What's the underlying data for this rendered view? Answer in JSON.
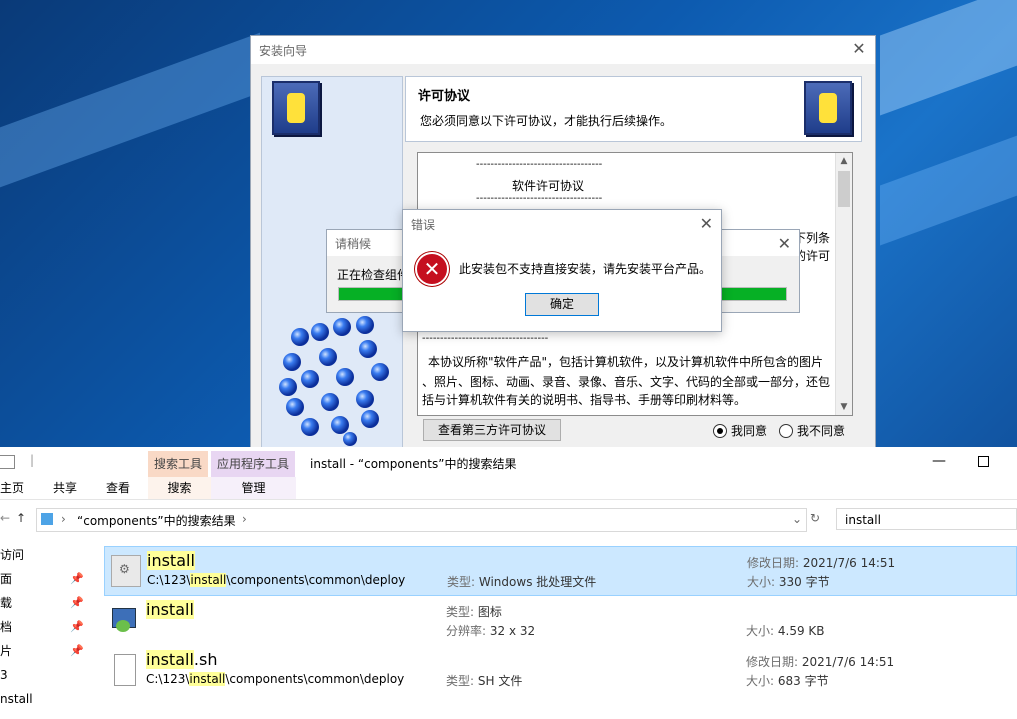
{
  "wizard": {
    "title": "安装向导",
    "header_title": "许可协议",
    "header_sub": "您必须同意以下许可协议，才能执行后续操作。",
    "license_lines": [
      "-----------------------------------",
      "软件许可协议",
      "-----------------------------------",
      "下列条",
      "的许可",
      "-----------------------------------",
      "本协议所称\"软件产品\"，包括计算机软件，以及计算机软件中所包含的图片",
      "、照片、图标、动画、录音、录像、音乐、文字、代码的全部或一部分，还包",
      "括与计算机软件有关的说明书、指导书、手册等印刷材料等。"
    ],
    "third_party_button": "查看第三方许可协议",
    "agree_label": "我同意",
    "disagree_label": "我不同意"
  },
  "wait_dialog": {
    "title": "请稍候",
    "text": "正在检查组件",
    "progress": 1.0
  },
  "error_dialog": {
    "title": "错误",
    "message": "此安装包不支持直接安装，请先安装平台产品。",
    "ok_button": "确定"
  },
  "explorer": {
    "context_tab_search": "搜索工具",
    "context_tab_app": "应用程序工具",
    "window_title": "install - “components”中的搜索结果",
    "ribbon_tabs": [
      "主页",
      "共享",
      "查看",
      "搜索",
      "管理"
    ],
    "address": "“components”中的搜索结果",
    "search_value": "install",
    "nav_items": [
      "访问",
      "面",
      "载",
      "档",
      "片",
      "3",
      "nstall"
    ],
    "results": [
      {
        "name_hl": "install",
        "name_rest": "",
        "path_pre": "C:\\123\\",
        "path_hl": "install",
        "path_post": "\\components\\common\\deploy",
        "type_key": "类型:",
        "type_val": "Windows 批处理文件",
        "date_key": "修改日期:",
        "date_val": "2021/7/6 14:51",
        "size_key": "大小:",
        "size_val": "330 字节"
      },
      {
        "name_hl": "install",
        "name_rest": "",
        "type_key": "类型:",
        "type_val": "图标",
        "res_key": "分辨率:",
        "res_val": "32 x 32",
        "size_key": "大小:",
        "size_val": "4.59 KB"
      },
      {
        "name_hl": "install",
        "name_rest": ".sh",
        "path_pre": "C:\\123\\",
        "path_hl": "install",
        "path_post": "\\components\\common\\deploy",
        "type_key": "类型:",
        "type_val": "SH 文件",
        "date_key": "修改日期:",
        "date_val": "2021/7/6 14:51",
        "size_key": "大小:",
        "size_val": "683 字节"
      }
    ]
  }
}
